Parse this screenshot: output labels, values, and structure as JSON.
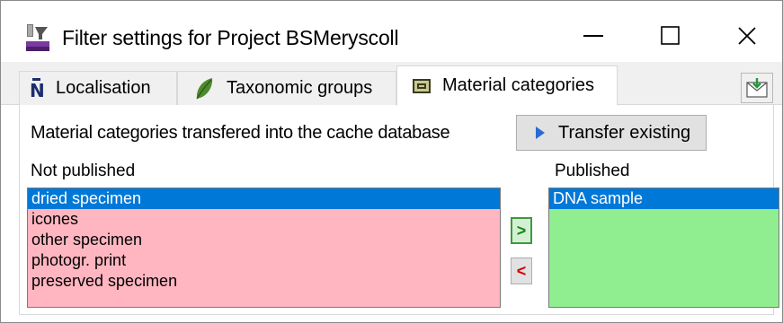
{
  "window": {
    "title": "Filter settings for Project BSMeryscoll",
    "controls": {
      "minimize": "—",
      "maximize": "☐",
      "close": "✕"
    }
  },
  "tabs": [
    {
      "label": "Localisation",
      "icon": "localisation-icon"
    },
    {
      "label": "Taxonomic groups",
      "icon": "leaf-icon"
    },
    {
      "label": "Material categories",
      "icon": "category-icon",
      "active": true
    }
  ],
  "main": {
    "description": "Material categories transfered into the cache database",
    "transfer_button": "Transfer existing",
    "not_published_label": "Not published",
    "published_label": "Published",
    "not_published_items": [
      {
        "label": "dried specimen",
        "selected": true
      },
      {
        "label": "icones",
        "selected": false
      },
      {
        "label": "other specimen",
        "selected": false
      },
      {
        "label": "photogr. print",
        "selected": false
      },
      {
        "label": "preserved specimen",
        "selected": false
      }
    ],
    "published_items": [
      {
        "label": "DNA sample",
        "selected": true
      }
    ],
    "move_right": ">",
    "move_left": "<"
  },
  "colors": {
    "not_published_bg": "#ffb6c1",
    "published_bg": "#90ee90",
    "selection": "#0078d7"
  }
}
